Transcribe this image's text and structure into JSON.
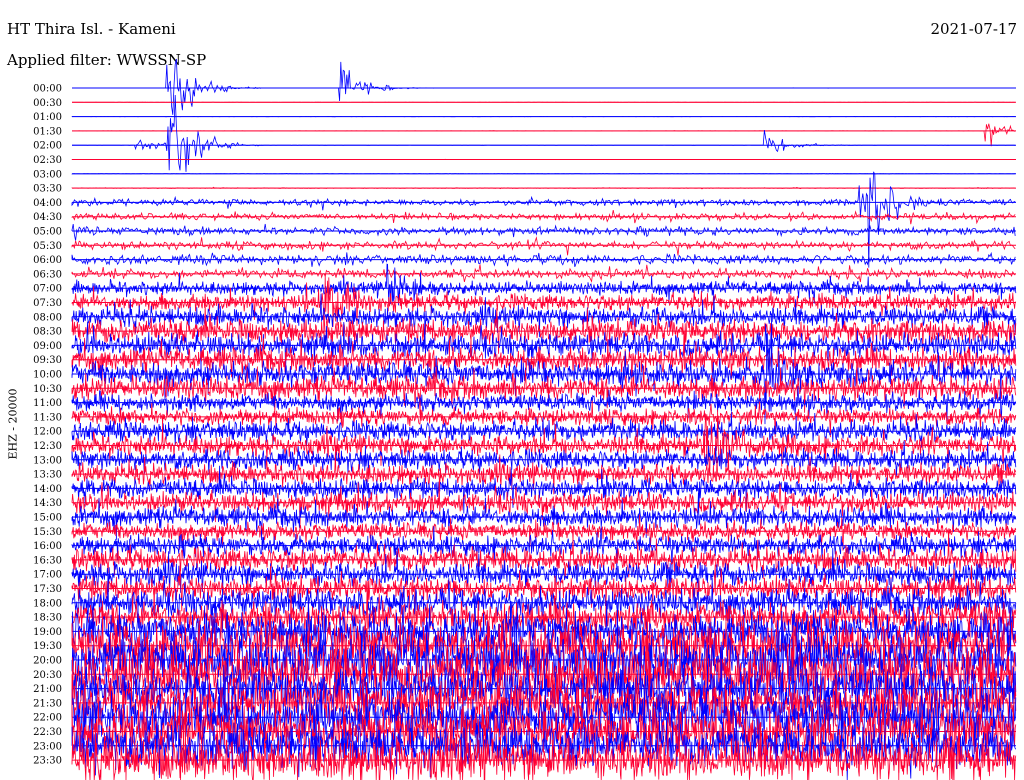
{
  "header": {
    "station": "HT Thira Isl. - Kameni",
    "date": "2021-07-17",
    "filter": "Applied filter: WWSSN-SP"
  },
  "chart_data": {
    "type": "line",
    "ylabel": "EHZ - 20000",
    "colors": {
      "even": "#0000ff",
      "odd": "#ff0033"
    },
    "rows": [
      "00:00",
      "00:30",
      "01:00",
      "01:30",
      "02:00",
      "02:30",
      "03:00",
      "03:30",
      "04:00",
      "04:30",
      "05:00",
      "05:30",
      "06:00",
      "06:30",
      "07:00",
      "07:30",
      "08:00",
      "08:30",
      "09:00",
      "09:30",
      "10:00",
      "10:30",
      "11:00",
      "11:30",
      "12:00",
      "12:30",
      "13:00",
      "13:30",
      "14:00",
      "14:30",
      "15:00",
      "15:30",
      "16:00",
      "16:30",
      "17:00",
      "17:30",
      "18:00",
      "18:30",
      "19:00",
      "19:30",
      "20:00",
      "20:30",
      "21:00",
      "21:30",
      "22:00",
      "22:30",
      "23:00",
      "23:30"
    ],
    "amplitude": [
      0.1,
      0.1,
      0.1,
      0.1,
      0.1,
      0.1,
      0.2,
      0.4,
      4,
      4,
      5,
      5,
      6,
      6,
      8,
      10,
      12,
      14,
      14,
      14,
      14,
      14,
      10,
      10,
      12,
      12,
      12,
      12,
      12,
      12,
      12,
      10,
      12,
      14,
      14,
      14,
      16,
      18,
      22,
      28,
      30,
      30,
      26,
      26,
      28,
      28,
      26,
      26
    ],
    "events": [
      {
        "row": 4,
        "min": 3,
        "amp": 110
      },
      {
        "row": 0,
        "min": 3,
        "amp": 85
      },
      {
        "row": 4,
        "min": 22,
        "amp": 25
      },
      {
        "row": 0,
        "min": 8.5,
        "amp": 40
      },
      {
        "row": 4,
        "min": 2,
        "amp": 18
      },
      {
        "row": 3,
        "min": 29,
        "amp": 30
      },
      {
        "row": 8,
        "min": 25,
        "amp": 120
      },
      {
        "row": 14,
        "min": 10,
        "amp": 30
      },
      {
        "row": 20,
        "min": 22,
        "amp": 60
      },
      {
        "row": 25,
        "min": 20,
        "amp": 55
      },
      {
        "row": 15,
        "min": 8,
        "amp": 45
      }
    ]
  }
}
